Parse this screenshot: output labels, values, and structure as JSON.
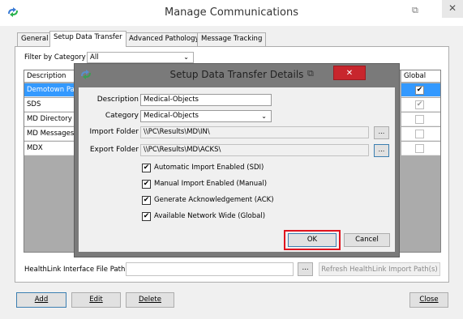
{
  "window": {
    "title": "Manage Communications",
    "restore_icon": "⧉",
    "close_icon": "✕"
  },
  "tabs": [
    {
      "label": "General"
    },
    {
      "label": "Setup Data Transfer"
    },
    {
      "label": "Advanced Pathology"
    },
    {
      "label": "Message Tracking"
    }
  ],
  "filter": {
    "label": "Filter by Category",
    "value": "All"
  },
  "list": {
    "columns": {
      "description": "Description",
      "global": "Global"
    },
    "rows": [
      {
        "description": "Demotown Path",
        "global": true,
        "selected": true
      },
      {
        "description": "SDS",
        "global": true,
        "selected": false
      },
      {
        "description": "MD Directory",
        "global": false,
        "selected": false
      },
      {
        "description": "MD Messages",
        "global": false,
        "selected": false
      },
      {
        "description": "MDX",
        "global": false,
        "selected": false
      }
    ]
  },
  "healthlink": {
    "label": "HealthLink Interface File Path",
    "value": "",
    "browse_label": "...",
    "refresh_label": "Refresh HealthLink Import Path(s)"
  },
  "footer": {
    "add": "Add",
    "edit": "Edit",
    "delete": "Delete",
    "close": "Close"
  },
  "dialog": {
    "title": "Setup Data Transfer Details",
    "restore_icon": "⧉",
    "close_icon": "✕",
    "description_label": "Description",
    "description_value": "Medical-Objects",
    "category_label": "Category",
    "category_value": "Medical-Objects",
    "import_label": "Import Folder",
    "import_value": "\\\\PC\\Results\\MD\\IN\\",
    "export_label": "Export Folder",
    "export_value": "\\\\PC\\Results\\MD\\ACKS\\",
    "browse_label": "...",
    "options": [
      {
        "label": "Automatic Import Enabled (SDI)",
        "checked": true
      },
      {
        "label": "Manual Import Enabled (Manual)",
        "checked": true
      },
      {
        "label": "Generate Acknowledgement (ACK)",
        "checked": true
      },
      {
        "label": "Available Network Wide (Global)",
        "checked": true
      }
    ],
    "ok_label": "OK",
    "cancel_label": "Cancel"
  },
  "colors": {
    "selection": "#3399ff",
    "highlight_box": "#e0141e",
    "dialog_close": "#c8262d"
  }
}
